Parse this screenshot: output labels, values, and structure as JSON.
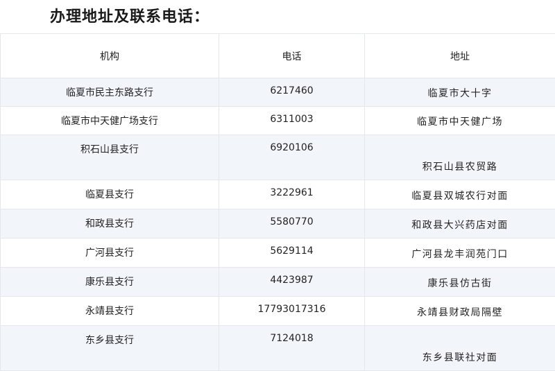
{
  "heading": "办理地址及联系电话：",
  "table": {
    "headers": [
      "机构",
      "电话",
      "地址"
    ],
    "rows": [
      {
        "name": "临夏市民主东路支行",
        "phone": "6217460",
        "address": "临夏市大十字"
      },
      {
        "name": "临夏市中天健广场支行",
        "phone": "6311003",
        "address": "临夏市中天健广场"
      },
      {
        "name": "积石山县支行",
        "phone": "6920106",
        "address": "积石山县农贸路"
      },
      {
        "name": "临夏县支行",
        "phone": "3222961",
        "address": "临夏县双城农行对面"
      },
      {
        "name": "和政县支行",
        "phone": "5580770",
        "address": "和政县大兴药店对面"
      },
      {
        "name": "广河县支行",
        "phone": "5629114",
        "address": "广河县龙丰润苑门口"
      },
      {
        "name": "康乐县支行",
        "phone": "4423987",
        "address": "康乐县仿古街"
      },
      {
        "name": "永靖县支行",
        "phone": "17793017316",
        "address": "永靖县财政局隔壁"
      },
      {
        "name": "东乡县支行",
        "phone": "7124018",
        "address": "东乡县联社对面"
      }
    ]
  }
}
